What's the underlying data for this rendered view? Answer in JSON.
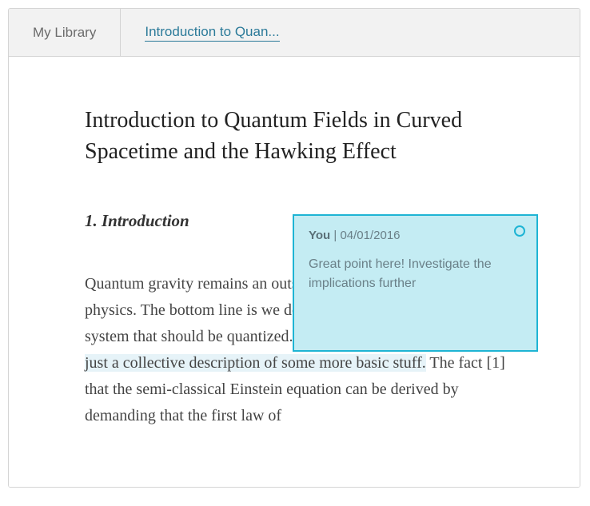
{
  "tabs": {
    "library": "My Library",
    "document": "Introduction to Quan..."
  },
  "paper": {
    "title": "Introduction to Quantum Fields in Curved Spacetime and the Hawking Effect",
    "section_heading": "1. Introduction",
    "body_pre": "Quantum gravity remains an outstanding problem of fundamental physics. The bottom line is we don't even know the nature of the system that should be quantized. ",
    "body_highlight": "The spacetime metric may well be just a collective description of some more basic stuff.",
    "body_post": " The fact [1] that the semi-classical Einstein equation can be derived by demanding that the first law of"
  },
  "annotation": {
    "author": "You",
    "separator": " | ",
    "date": "04/01/2016",
    "text": "Great point here! Investigate the implications further"
  }
}
